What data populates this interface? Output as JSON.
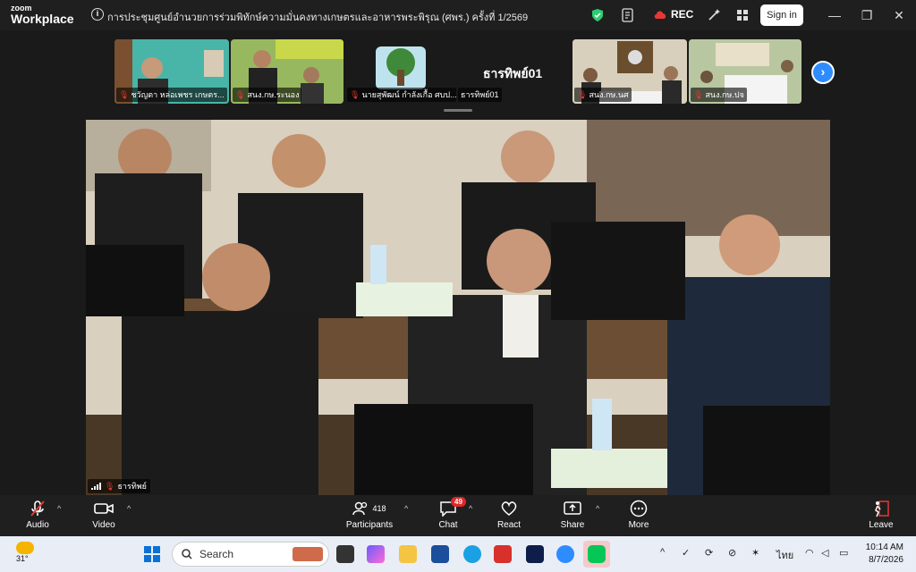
{
  "app": {
    "brand_small": "zoom",
    "brand_large": "Workplace"
  },
  "meeting": {
    "title": "การประชุมศูนย์อำนวยการร่วมพิทักษ์ความมั่นคงทางเกษตรและอาหารพระพิรุณ (ศพร.) ครั้งที่ 1/2569"
  },
  "titlebar": {
    "rec_label": "REC",
    "signin_label": "Sign in"
  },
  "thumbnails": [
    {
      "name": "ชวัญตา  หล่อเพชร เกษตร..."
    },
    {
      "name": "สนง.กษ.ระนอง"
    },
    {
      "name": "นายสุพัฒน์ กำลังเกื้อ  ศบป..."
    },
    {
      "name": "ธารทิพย์01",
      "big_label": "ธารทิพย์01"
    },
    {
      "name": "สนง.กษ.นศ"
    },
    {
      "name": "สนง.กษ.ปจ"
    }
  ],
  "main_video": {
    "label": "ธารทิพย์"
  },
  "controls": {
    "audio": "Audio",
    "video": "Video",
    "participants": "Participants",
    "participants_count": "418",
    "chat": "Chat",
    "chat_badge": "49",
    "react": "React",
    "share": "Share",
    "more": "More",
    "leave": "Leave"
  },
  "taskbar": {
    "weather": "31°",
    "search_placeholder": "Search",
    "lang": "ไทย",
    "time": "10:14 AM",
    "date": "8/7/2026"
  },
  "colors": {
    "accent": "#2d8cff",
    "mute_red": "#e53935",
    "bg": "#1a1a1a"
  }
}
